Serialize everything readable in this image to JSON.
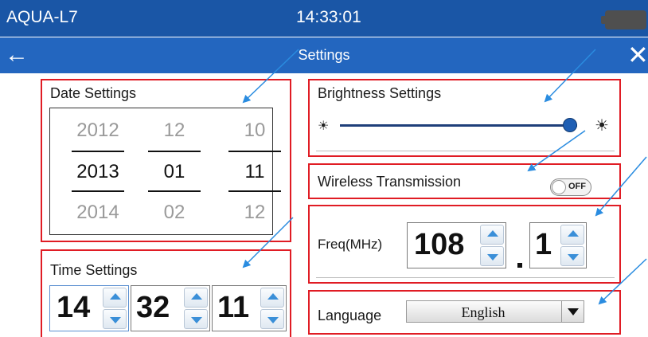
{
  "status_bar": {
    "app_name": "AQUA-L7",
    "clock": "14:33:01"
  },
  "title_bar": {
    "title": "Settings",
    "back_icon": "←",
    "close_icon": "✕"
  },
  "date_settings": {
    "label": "Date Settings",
    "years": [
      "2012",
      "2013",
      "2014"
    ],
    "months": [
      "12",
      "01",
      "02"
    ],
    "days": [
      "10",
      "11",
      "12"
    ]
  },
  "brightness_settings": {
    "label": "Brightness Settings",
    "level_fraction": 0.97,
    "icon_low": "☀",
    "icon_high": "☀"
  },
  "wireless_transmission": {
    "label": "Wireless Transmission",
    "state": "OFF"
  },
  "frequency": {
    "label": "Freq(MHz)",
    "integer_part": "108",
    "decimal_part": "1"
  },
  "time_settings": {
    "label": "Time Settings",
    "hour": "14",
    "minute": "32",
    "second": "11"
  },
  "language": {
    "label": "Language",
    "selected": "English"
  },
  "colors": {
    "accent_red": "#e01c24",
    "header_blue": "#1a56a6",
    "arrow_blue": "#2a8ce0"
  }
}
